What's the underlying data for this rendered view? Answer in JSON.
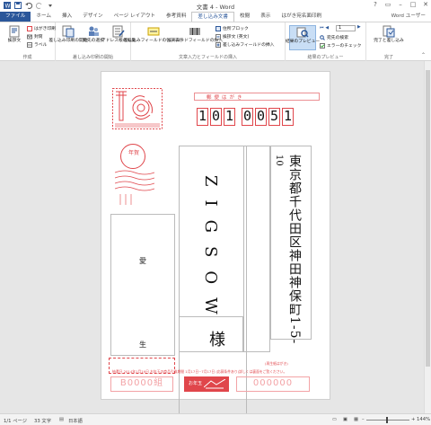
{
  "window": {
    "title": "文書 4 - Word",
    "user": "Word ユーザー"
  },
  "tabs": [
    "ファイル",
    "ホーム",
    "挿入",
    "デザイン",
    "ページ レイアウト",
    "参考資料",
    "差し込み文書",
    "校閲",
    "表示",
    "はがき宛名面印刷"
  ],
  "ribbon": {
    "create": {
      "label": "作成",
      "envelopes": "封筒",
      "labels": "ラベル",
      "postcard": "はがき印刷",
      "greeting": "挨拶文"
    },
    "start": {
      "label": "差し込み印刷の開始",
      "start_merge": "差し込み印刷の開始",
      "select_recipients": "宛先の選択",
      "edit_list": "アドレス帳の編集"
    },
    "fields": {
      "label": "文章入力とフィールドの挿入",
      "highlight": "差し込みフィールドの強調表示",
      "barcode": "バーコードフィールドの挿入",
      "address_block": "住所ブロック",
      "greeting_line": "挨拶文 (英文)",
      "insert_field": "差し込みフィールドの挿入"
    },
    "preview": {
      "label": "結果のプレビュー",
      "preview_btn": "結果のプレビュー",
      "record": "1",
      "find": "宛先の検索",
      "check": "エラーのチェック"
    },
    "finish": {
      "label": "完了",
      "finish_btn": "完了と差し込み"
    }
  },
  "postcard": {
    "header": "郵便はがき",
    "zip": [
      "1",
      "0",
      "1",
      "0",
      "0",
      "5",
      "1"
    ],
    "address": "東京都千代田区神田神保町1-5-",
    "address_num": "10",
    "recipient": "ZIGSOW",
    "honorific": "様",
    "sender_top": "愛",
    "sender_bottom": "生",
    "stamp_text": "年賀",
    "lottery_left": "B0000組",
    "lottery_right": "000000",
    "lottery_center": "お年玉",
    "note_right": "(再生紙はがき)",
    "footnote": "抽選日 2014年1月19日 お年玉の商品引換期間 1月17日~7月17日 (応募条件あり)詳しくは裏面をご覧ください。"
  },
  "status": {
    "page": "1/1 ページ",
    "words": "33 文字",
    "lang": "日本語",
    "zoom": "144%"
  },
  "colors": {
    "accent": "#2b579a",
    "postcard_red": "#e0464b"
  }
}
